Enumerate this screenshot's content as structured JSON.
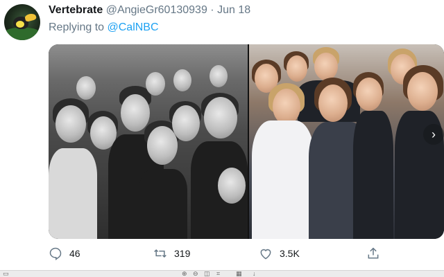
{
  "tweet": {
    "display_name": "Vertebrate",
    "handle": "@AngieGr60130939",
    "separator": "·",
    "date": "Jun 18",
    "replying_prefix": "Replying to",
    "replying_to": "@CalNBC",
    "avatar_icon": "toucan-avatar-icon",
    "media_next_icon": "chevron-right-icon"
  },
  "actions": {
    "reply": {
      "icon": "reply-icon",
      "count": "46"
    },
    "retweet": {
      "icon": "retweet-icon",
      "count": "319"
    },
    "like": {
      "icon": "heart-icon",
      "count": "3.5K"
    },
    "share": {
      "icon": "share-icon"
    }
  },
  "colors": {
    "accent": "#1da1f2",
    "secondary_text": "#657786",
    "primary_text": "#14171a"
  }
}
